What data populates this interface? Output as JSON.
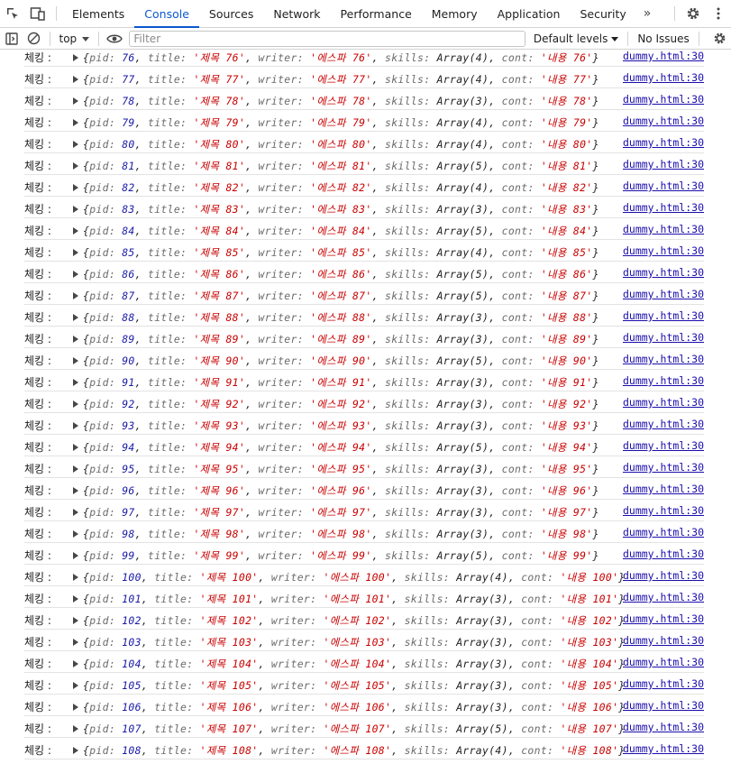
{
  "devtools": {
    "tabs": [
      "Elements",
      "Console",
      "Sources",
      "Network",
      "Performance",
      "Memory",
      "Application",
      "Security"
    ],
    "active_tab": "Console",
    "more_tabs_glyph": "»"
  },
  "toolbar": {
    "context": "top",
    "filter_placeholder": "Filter",
    "levels": "Default levels",
    "issues": "No Issues"
  },
  "console": {
    "prefix": "체킹 :",
    "source": "dummy.html:30",
    "keys": {
      "pid": "pid",
      "title": "title",
      "writer": "writer",
      "skills": "skills",
      "cont": "cont"
    },
    "rows": [
      {
        "pid": "76",
        "title": "제목 76",
        "writer": "에스파 76",
        "skills": "Array(4)",
        "cont": "내용 76"
      },
      {
        "pid": "77",
        "title": "제목 77",
        "writer": "에스파 77",
        "skills": "Array(4)",
        "cont": "내용 77"
      },
      {
        "pid": "78",
        "title": "제목 78",
        "writer": "에스파 78",
        "skills": "Array(3)",
        "cont": "내용 78"
      },
      {
        "pid": "79",
        "title": "제목 79",
        "writer": "에스파 79",
        "skills": "Array(4)",
        "cont": "내용 79"
      },
      {
        "pid": "80",
        "title": "제목 80",
        "writer": "에스파 80",
        "skills": "Array(4)",
        "cont": "내용 80"
      },
      {
        "pid": "81",
        "title": "제목 81",
        "writer": "에스파 81",
        "skills": "Array(5)",
        "cont": "내용 81"
      },
      {
        "pid": "82",
        "title": "제목 82",
        "writer": "에스파 82",
        "skills": "Array(4)",
        "cont": "내용 82"
      },
      {
        "pid": "83",
        "title": "제목 83",
        "writer": "에스파 83",
        "skills": "Array(3)",
        "cont": "내용 83"
      },
      {
        "pid": "84",
        "title": "제목 84",
        "writer": "에스파 84",
        "skills": "Array(5)",
        "cont": "내용 84"
      },
      {
        "pid": "85",
        "title": "제목 85",
        "writer": "에스파 85",
        "skills": "Array(4)",
        "cont": "내용 85"
      },
      {
        "pid": "86",
        "title": "제목 86",
        "writer": "에스파 86",
        "skills": "Array(5)",
        "cont": "내용 86"
      },
      {
        "pid": "87",
        "title": "제목 87",
        "writer": "에스파 87",
        "skills": "Array(5)",
        "cont": "내용 87"
      },
      {
        "pid": "88",
        "title": "제목 88",
        "writer": "에스파 88",
        "skills": "Array(3)",
        "cont": "내용 88"
      },
      {
        "pid": "89",
        "title": "제목 89",
        "writer": "에스파 89",
        "skills": "Array(3)",
        "cont": "내용 89"
      },
      {
        "pid": "90",
        "title": "제목 90",
        "writer": "에스파 90",
        "skills": "Array(5)",
        "cont": "내용 90"
      },
      {
        "pid": "91",
        "title": "제목 91",
        "writer": "에스파 91",
        "skills": "Array(3)",
        "cont": "내용 91"
      },
      {
        "pid": "92",
        "title": "제목 92",
        "writer": "에스파 92",
        "skills": "Array(3)",
        "cont": "내용 92"
      },
      {
        "pid": "93",
        "title": "제목 93",
        "writer": "에스파 93",
        "skills": "Array(3)",
        "cont": "내용 93"
      },
      {
        "pid": "94",
        "title": "제목 94",
        "writer": "에스파 94",
        "skills": "Array(5)",
        "cont": "내용 94"
      },
      {
        "pid": "95",
        "title": "제목 95",
        "writer": "에스파 95",
        "skills": "Array(3)",
        "cont": "내용 95"
      },
      {
        "pid": "96",
        "title": "제목 96",
        "writer": "에스파 96",
        "skills": "Array(3)",
        "cont": "내용 96"
      },
      {
        "pid": "97",
        "title": "제목 97",
        "writer": "에스파 97",
        "skills": "Array(3)",
        "cont": "내용 97"
      },
      {
        "pid": "98",
        "title": "제목 98",
        "writer": "에스파 98",
        "skills": "Array(3)",
        "cont": "내용 98"
      },
      {
        "pid": "99",
        "title": "제목 99",
        "writer": "에스파 99",
        "skills": "Array(5)",
        "cont": "내용 99"
      },
      {
        "pid": "100",
        "title": "제목 100",
        "writer": "에스파 100",
        "skills": "Array(4)",
        "cont": "내용 100"
      },
      {
        "pid": "101",
        "title": "제목 101",
        "writer": "에스파 101",
        "skills": "Array(3)",
        "cont": "내용 101"
      },
      {
        "pid": "102",
        "title": "제목 102",
        "writer": "에스파 102",
        "skills": "Array(3)",
        "cont": "내용 102"
      },
      {
        "pid": "103",
        "title": "제목 103",
        "writer": "에스파 103",
        "skills": "Array(3)",
        "cont": "내용 103"
      },
      {
        "pid": "104",
        "title": "제목 104",
        "writer": "에스파 104",
        "skills": "Array(3)",
        "cont": "내용 104"
      },
      {
        "pid": "105",
        "title": "제목 105",
        "writer": "에스파 105",
        "skills": "Array(3)",
        "cont": "내용 105"
      },
      {
        "pid": "106",
        "title": "제목 106",
        "writer": "에스파 106",
        "skills": "Array(3)",
        "cont": "내용 106"
      },
      {
        "pid": "107",
        "title": "제목 107",
        "writer": "에스파 107",
        "skills": "Array(5)",
        "cont": "내용 107"
      },
      {
        "pid": "108",
        "title": "제목 108",
        "writer": "에스파 108",
        "skills": "Array(4)",
        "cont": "내용 108"
      }
    ]
  },
  "icons": {
    "inspect": "inspect-element-icon",
    "device": "device-toolbar-icon",
    "sidebar": "sidebar-toggle-icon",
    "clear": "clear-console-icon",
    "eye": "live-expression-icon",
    "settings": "gear-icon",
    "menu": "kebab-menu-icon"
  }
}
